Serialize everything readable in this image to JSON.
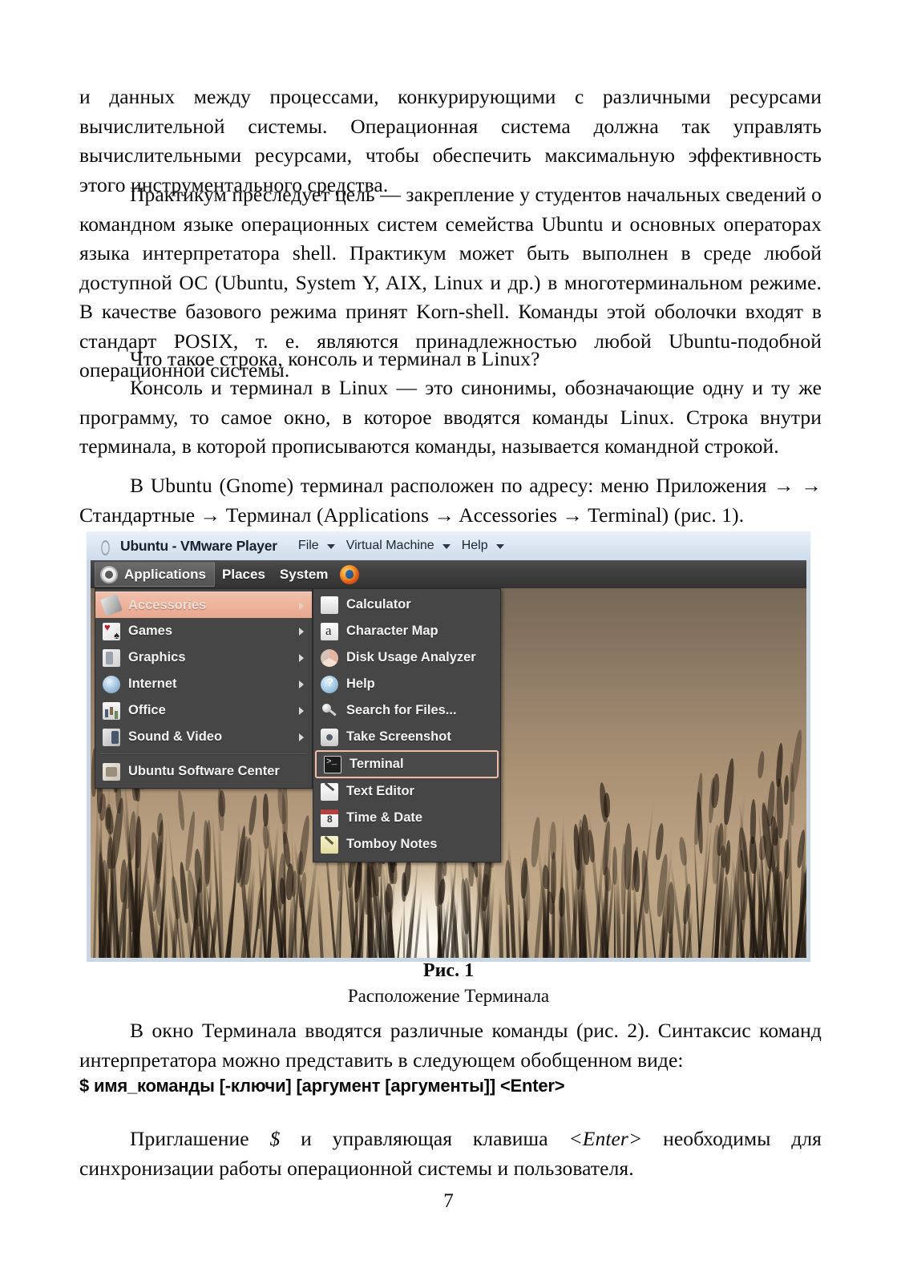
{
  "document": {
    "page_number": "7",
    "paragraphs": [
      "и данных между процессами, конкурирующими с различными ресурсами вычислительной системы. Операционная система должна так управлять вычислительными ресурсами, чтобы обеспечить максимальную эффективность этого инструментального средства.",
      "Практикум преследует цель — закрепление у студентов начальных сведений о командном языке операционных систем семейства Ubuntu и основных операторах языка интерпретатора shell. Практикум может быть выполнен в среде любой доступной ОС (Ubuntu, System Y, AIX, Linux и др.) в многотерминальном режиме. В качестве базового режима принят Korn-shell. Команды этой оболочки входят в стандарт POSIX, т. е. являются принадлежностью любой Ubuntu-подобной операционной системы.",
      "Что такое строка, консоль и терминал в Linux?",
      "Консоль и терминал в Linux — это синонимы, обозначающие одну и ту же программу, то самое окно, в которое вводятся команды Linux. Строка внутри терминала, в которой прописываются команды, называется командной строкой.",
      "В Ubuntu (Gnome) терминал расположен по адресу: меню Приложения → → Стандартные → Терминал (Applications → Accessories → Terminal) (рис. 1)."
    ],
    "after_figure_paragraph": "В окно Терминала вводятся различные команды (рис. 2). Синтаксис команд интерпретатора можно представить в следующем обобщенном виде:",
    "command_syntax": "$ имя_команды [-ключи] [аргумент [аргументы]] <Enter>",
    "closing_paragraph_parts": {
      "before": "Приглашение ",
      "italic1": "$",
      "middle": " и управляющая клавиша ",
      "italic2": "<Enter>",
      "after": " необходимы для синхронизации работы операционной системы и пользователя."
    }
  },
  "figure": {
    "caption_number": "Рис. 1",
    "caption_text": "Расположение Терминала",
    "vmware": {
      "title": "Ubuntu - VMware Player",
      "menus": [
        "File",
        "Virtual Machine",
        "Help"
      ]
    },
    "gnome_panel": {
      "applications": "Applications",
      "places": "Places",
      "system": "System"
    },
    "main_menu": {
      "items": [
        {
          "label": "Accessories",
          "icon": "accessories-icon",
          "has_submenu": true,
          "selected": true
        },
        {
          "label": "Games",
          "icon": "games-icon",
          "has_submenu": true,
          "selected": false
        },
        {
          "label": "Graphics",
          "icon": "graphics-icon",
          "has_submenu": true,
          "selected": false
        },
        {
          "label": "Internet",
          "icon": "internet-icon",
          "has_submenu": true,
          "selected": false
        },
        {
          "label": "Office",
          "icon": "office-icon",
          "has_submenu": true,
          "selected": false
        },
        {
          "label": "Sound & Video",
          "icon": "sound-video-icon",
          "has_submenu": true,
          "selected": false
        },
        {
          "label": "Ubuntu Software Center",
          "icon": "ubuntu-software-center-icon",
          "has_submenu": false,
          "selected": false
        }
      ]
    },
    "sub_menu": {
      "items": [
        {
          "label": "Calculator",
          "icon": "calculator-icon",
          "selected": false
        },
        {
          "label": "Character Map",
          "icon": "character-map-icon",
          "selected": false
        },
        {
          "label": "Disk Usage Analyzer",
          "icon": "disk-usage-icon",
          "selected": false
        },
        {
          "label": "Help",
          "icon": "help-icon",
          "selected": false
        },
        {
          "label": "Search for Files...",
          "icon": "search-icon",
          "selected": false
        },
        {
          "label": "Take Screenshot",
          "icon": "camera-icon",
          "selected": false
        },
        {
          "label": "Terminal",
          "icon": "terminal-icon",
          "selected": true
        },
        {
          "label": "Text Editor",
          "icon": "text-editor-icon",
          "selected": false
        },
        {
          "label": "Time & Date",
          "icon": "time-date-icon",
          "selected": false
        },
        {
          "label": "Tomboy Notes",
          "icon": "tomboy-notes-icon",
          "selected": false
        }
      ]
    },
    "colors": {
      "menu_background": "#464646",
      "selection_highlight": "#eeb49c",
      "panel_background": "#3f3f3f",
      "titlebar_background": "#dbe7f2",
      "wallpaper_tone": "#a99073"
    }
  }
}
